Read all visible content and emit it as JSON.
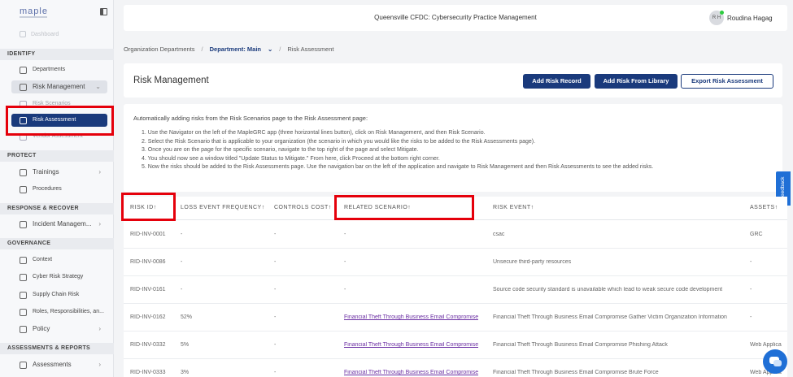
{
  "sidebar": {
    "logo": "maple",
    "dashboard": "Dashboard",
    "sections": [
      "IDENTIFY",
      "PROTECT",
      "RESPONSE & RECOVER",
      "GOVERNANCE",
      "ASSESSMENTS & REPORTS"
    ],
    "items": {
      "departments": "Departments",
      "risk_management": "Risk Management",
      "risk_scenarios": "Risk Scenarios",
      "risk_assessment": "Risk Assessment",
      "vendor_assessment": "Vendor Assessment",
      "trainings": "Trainings",
      "procedures": "Procedures",
      "incident_management": "Incident Managem...",
      "context": "Context",
      "cyber_risk_strategy": "Cyber Risk Strategy",
      "supply_chain_risk": "Supply Chain Risk",
      "roles": "Roles, Responsibilities, an...",
      "policy": "Policy",
      "assessments": "Assessments"
    }
  },
  "header": {
    "title": "Queensville CFDC: Cybersecurity Practice Management",
    "avatar_initials": "R H",
    "user_name": "Roudina Hagag"
  },
  "breadcrumb": {
    "root": "Organization Departments",
    "sep": "/",
    "department": "Department: Main",
    "caret": "⌄",
    "current": "Risk Assessment"
  },
  "panel": {
    "title": "Risk Management",
    "add_record": "Add Risk Record",
    "add_library": "Add Risk From Library",
    "export": "Export Risk Assessment"
  },
  "instructions": {
    "heading": "Automatically adding risks from the Risk Scenarios page to the Risk Assessment page:",
    "steps": [
      "1. Use the Navigator on the left of the MapleGRC app (three horizontal lines button), click on Risk Management, and then Risk Scenario.",
      "2. Select the Risk Scenario that is applicable to your organization (the scenario in which you would like the risks to be added to the Risk Assessments page).",
      "3. Once you are on the page for the specific scenario, navigate to the top right of the page and select Mitigate.",
      "4. You should now see a window titled \"Update Status to Mitigate.\" From here, click Proceed at the bottom right corner.",
      "5. Now the risks should be added to the Risk Assessments page. Use the navigation bar on the left of the application and navigate to Risk Management and then Risk Assessments to see the added risks."
    ]
  },
  "feedback": "Feedback",
  "table": {
    "columns": [
      "RISK ID",
      "LOSS EVENT FREQUENCY",
      "CONTROLS COST",
      "RELATED SCENARIO",
      "RISK EVENT",
      "ASSETS"
    ],
    "sort_glyph": "↑",
    "rows": [
      {
        "id": "RID-INV-0001",
        "freq": "-",
        "cost": "-",
        "scenario": "-",
        "event": "csac",
        "assets": "GRC"
      },
      {
        "id": "RID-INV-0086",
        "freq": "-",
        "cost": "-",
        "scenario": "-",
        "event": "Unsecure third-party resources",
        "assets": "-"
      },
      {
        "id": "RID-INV-0161",
        "freq": "-",
        "cost": "-",
        "scenario": "-",
        "event": "Source code security standard is unavailable which lead to weak secure code development",
        "assets": "-"
      },
      {
        "id": "RID-INV-0162",
        "freq": "52%",
        "cost": "-",
        "scenario": "Financial Theft Through Business Email Compromise",
        "event": "Financial Theft Through Business Email Compromise Gather Victim Organization Information",
        "assets": "-"
      },
      {
        "id": "RID-INV-0332",
        "freq": "5%",
        "cost": "-",
        "scenario": "Financial Theft Through Business Email Compromise",
        "event": "Financial Theft Through Business Email Compromise Phishing Attack",
        "assets": "Web Applica"
      },
      {
        "id": "RID-INV-0333",
        "freq": "3%",
        "cost": "-",
        "scenario": "Financial Theft Through Business Email Compromise",
        "event": "Financial Theft Through Business Email Compromise Brute Force",
        "assets": "Web Applica"
      }
    ]
  },
  "colors": {
    "primary": "#1a3a7c",
    "highlight": "#e5000b",
    "link": "#6b2fa3"
  }
}
